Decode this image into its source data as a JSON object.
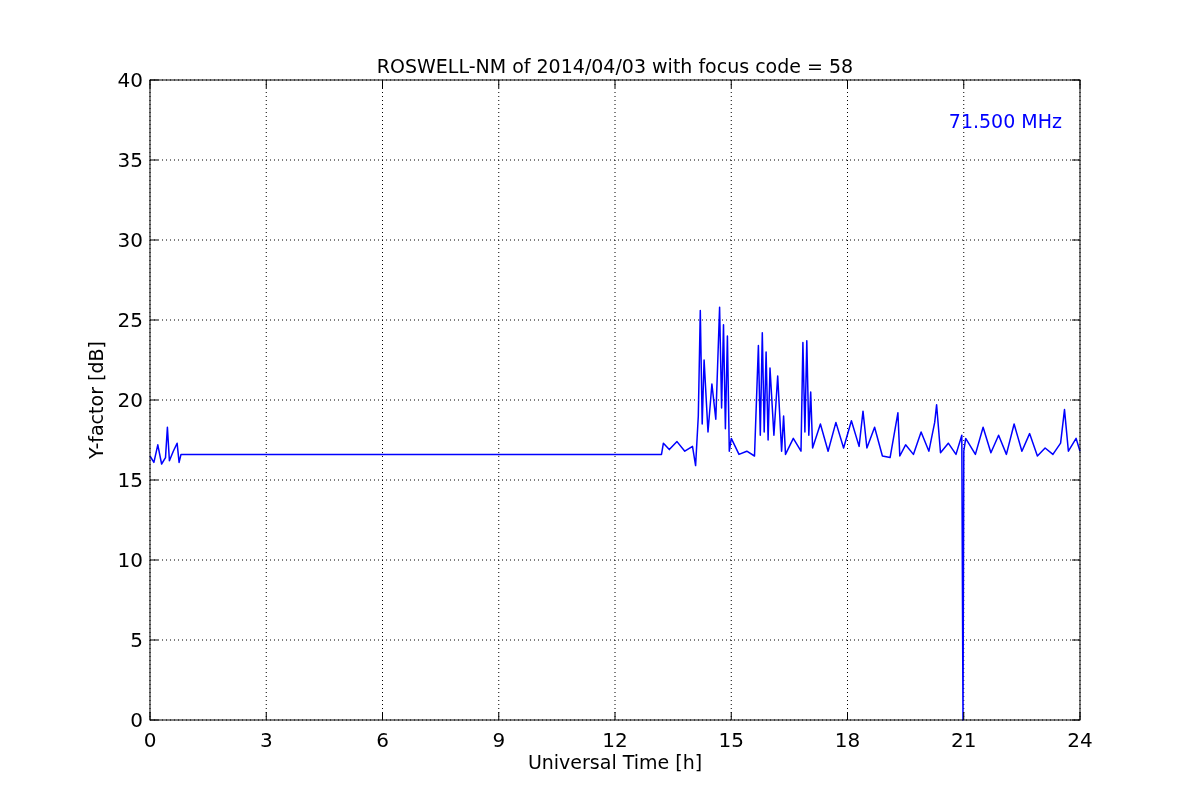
{
  "chart_data": {
    "type": "line",
    "title": "ROSWELL-NM of 2014/04/03 with focus code = 58",
    "xlabel": "Universal Time [h]",
    "ylabel": "Y-factor [dB]",
    "x": [
      0,
      0.1,
      0.2,
      0.3,
      0.4,
      0.45,
      0.5,
      0.6,
      0.7,
      0.75,
      0.8,
      13.2,
      13.25,
      13.4,
      13.6,
      13.8,
      14.0,
      14.08,
      14.15,
      14.2,
      14.25,
      14.3,
      14.4,
      14.5,
      14.6,
      14.7,
      14.75,
      14.8,
      14.85,
      14.9,
      14.95,
      15.0,
      15.2,
      15.4,
      15.6,
      15.7,
      15.75,
      15.8,
      15.85,
      15.9,
      15.95,
      16.0,
      16.1,
      16.2,
      16.3,
      16.35,
      16.4,
      16.6,
      16.8,
      16.85,
      16.9,
      16.95,
      17.0,
      17.05,
      17.1,
      17.3,
      17.5,
      17.7,
      17.9,
      18.1,
      18.3,
      18.4,
      18.5,
      18.7,
      18.9,
      19.1,
      19.3,
      19.35,
      19.5,
      19.7,
      19.9,
      20.1,
      20.25,
      20.3,
      20.4,
      20.6,
      20.8,
      20.95,
      20.98,
      21.0,
      21.05,
      21.3,
      21.5,
      21.7,
      21.9,
      22.1,
      22.3,
      22.5,
      22.7,
      22.9,
      23.1,
      23.3,
      23.5,
      23.6,
      23.7,
      23.9,
      24
    ],
    "series": [
      {
        "name": "71.500 MHz",
        "color": "#0000ff",
        "values": [
          16.5,
          16.1,
          17.2,
          16.0,
          16.4,
          18.3,
          16.2,
          16.8,
          17.3,
          16.1,
          16.6,
          16.6,
          17.3,
          16.9,
          17.4,
          16.8,
          17.1,
          15.9,
          19.0,
          25.6,
          18.5,
          22.5,
          18.0,
          21.0,
          18.8,
          25.8,
          19.5,
          24.7,
          18.2,
          24.0,
          16.8,
          17.6,
          16.6,
          16.8,
          16.5,
          23.4,
          17.8,
          24.2,
          18.0,
          23.0,
          17.5,
          22.0,
          17.8,
          21.5,
          16.8,
          19.0,
          16.6,
          17.6,
          16.8,
          23.6,
          18.0,
          23.7,
          17.8,
          20.5,
          17.0,
          18.5,
          16.8,
          18.6,
          17.0,
          18.7,
          17.1,
          19.3,
          17.0,
          18.3,
          16.5,
          16.4,
          19.2,
          16.5,
          17.2,
          16.6,
          18.0,
          16.8,
          18.6,
          19.7,
          16.7,
          17.3,
          16.6,
          17.8,
          0,
          16.8,
          17.6,
          16.6,
          18.3,
          16.7,
          17.8,
          16.6,
          18.5,
          16.8,
          17.9,
          16.5,
          17.0,
          16.6,
          17.3,
          19.4,
          16.8,
          17.6,
          16.8
        ]
      }
    ],
    "grid": true,
    "xlim": [
      0,
      24
    ],
    "ylim": [
      0,
      40
    ],
    "xticks": [
      0,
      3,
      6,
      9,
      12,
      15,
      18,
      21,
      24
    ],
    "yticks": [
      0,
      5,
      10,
      15,
      20,
      25,
      30,
      35,
      40
    ]
  }
}
